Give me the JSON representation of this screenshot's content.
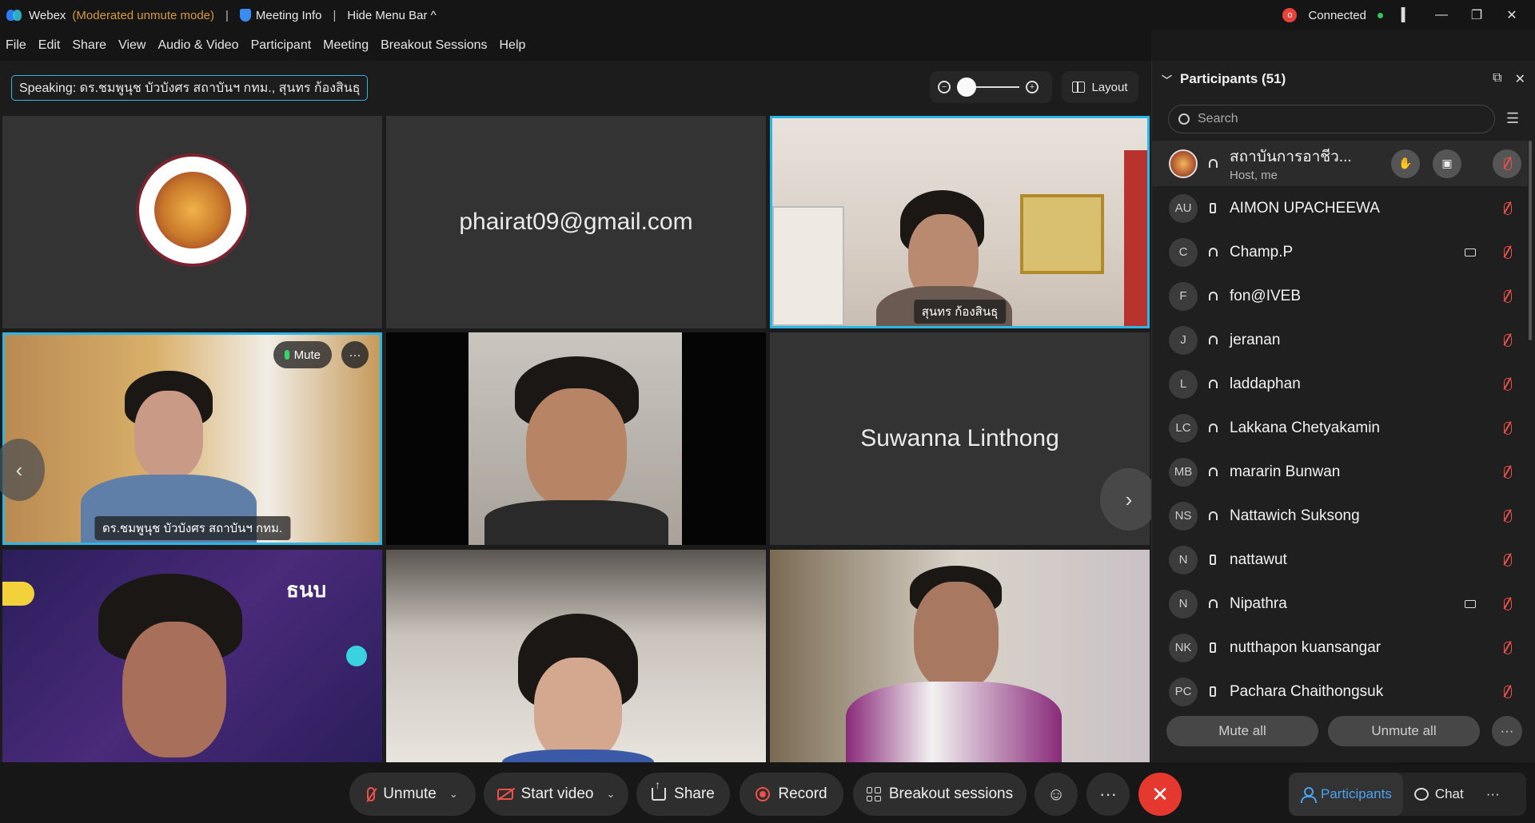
{
  "titlebar": {
    "app_name": "Webex",
    "mode": "(Moderated unmute mode)",
    "meeting_info": "Meeting Info",
    "hide_menu": "Hide Menu Bar ^",
    "status": "Connected",
    "rec_glyph": "o"
  },
  "menu": [
    "File",
    "Edit",
    "Share",
    "View",
    "Audio & Video",
    "Participant",
    "Meeting",
    "Breakout Sessions",
    "Help"
  ],
  "stage": {
    "speaking": "Speaking: ดร.ชมพูนุช บัวบังศร สถาบันฯ กทม., สุนทร ก้องสินธุ",
    "layout_label": "Layout"
  },
  "tiles": {
    "t2_name": "phairat09@gmail.com",
    "t3_label": "สุนทร ก้องสินธุ",
    "t4_label": "ดร.ชมพูนุช บัวบังศร สถาบันฯ กทม.",
    "t4_mute": "Mute",
    "t6_name": "Suwanna Linthong",
    "t7_overlay": "ธนบ"
  },
  "controls": {
    "unmute": "Unmute",
    "start_video": "Start video",
    "share": "Share",
    "record": "Record",
    "breakout": "Breakout sessions",
    "participants": "Participants",
    "chat": "Chat"
  },
  "panel": {
    "title": "Participants (51)",
    "search_placeholder": "Search",
    "host": {
      "name": "สถาบันการอาชีว...",
      "role": "Host, me"
    },
    "participants": [
      {
        "initials": "AU",
        "name": "AIMON UPACHEEWA",
        "device": "phone",
        "video": false
      },
      {
        "initials": "C",
        "name": "Champ.P",
        "device": "headset",
        "video": true
      },
      {
        "initials": "F",
        "name": "fon@IVEB",
        "device": "headset",
        "video": false
      },
      {
        "initials": "J",
        "name": "jeranan",
        "device": "headset",
        "video": false
      },
      {
        "initials": "L",
        "name": "laddaphan",
        "device": "headset",
        "video": false
      },
      {
        "initials": "LC",
        "name": "Lakkana Chetyakamin",
        "device": "headset",
        "video": false
      },
      {
        "initials": "MB",
        "name": "mararin Bunwan",
        "device": "headset",
        "video": false
      },
      {
        "initials": "NS",
        "name": "Nattawich Suksong",
        "device": "headset",
        "video": false
      },
      {
        "initials": "N",
        "name": "nattawut",
        "device": "phone",
        "video": false
      },
      {
        "initials": "N",
        "name": "Nipathra",
        "device": "headset",
        "video": true
      },
      {
        "initials": "NK",
        "name": "nutthapon kuansangar",
        "device": "phone",
        "video": false
      },
      {
        "initials": "PC",
        "name": "Pachara Chaithongsuk",
        "device": "phone",
        "video": false
      }
    ],
    "mute_all": "Mute all",
    "unmute_all": "Unmute all"
  },
  "colors": {
    "accent": "#2cb6e6",
    "muted_red": "#f0504a",
    "end_red": "#e5382f",
    "selected_blue": "#4aa3f2"
  }
}
